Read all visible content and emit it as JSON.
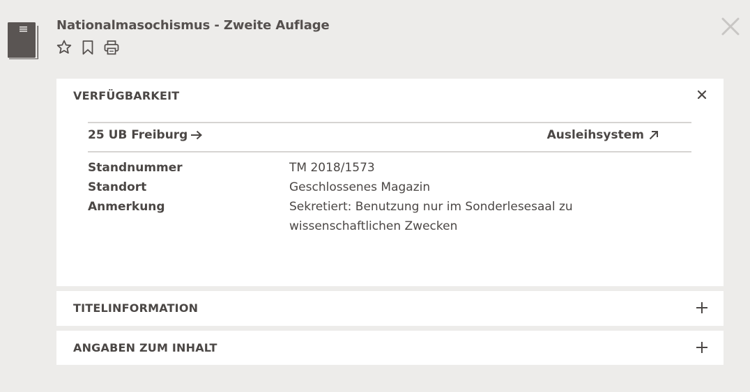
{
  "record": {
    "title": "Nationalmasochismus - Zweite Auflage",
    "type_icon": "book-icon"
  },
  "actions": [
    {
      "icon": "star-icon",
      "label": "Favorit"
    },
    {
      "icon": "bookmark-icon",
      "label": "Merken"
    },
    {
      "icon": "printer-icon",
      "label": "Drucken"
    }
  ],
  "availability": {
    "header": "VERFÜGBARKEIT",
    "library_link": "25 UB Freiburg",
    "external_link": "Ausleihsystem",
    "rows": [
      {
        "key": "Standnummer",
        "value": "TM 2018/1573"
      },
      {
        "key": "Standort",
        "value": "Geschlossenes Magazin"
      },
      {
        "key": "Anmerkung",
        "value": "Sekretiert: Benutzung nur im Sonderlesesaal zu wissenschaftlichen Zwecken"
      }
    ]
  },
  "sections": {
    "title_info": "TITELINFORMATION",
    "content_info": "ANGABEN ZUM INHALT"
  },
  "colors": {
    "background": "#edecea",
    "panel": "#ffffff",
    "text": "#4b4745",
    "icon": "#55504e"
  }
}
